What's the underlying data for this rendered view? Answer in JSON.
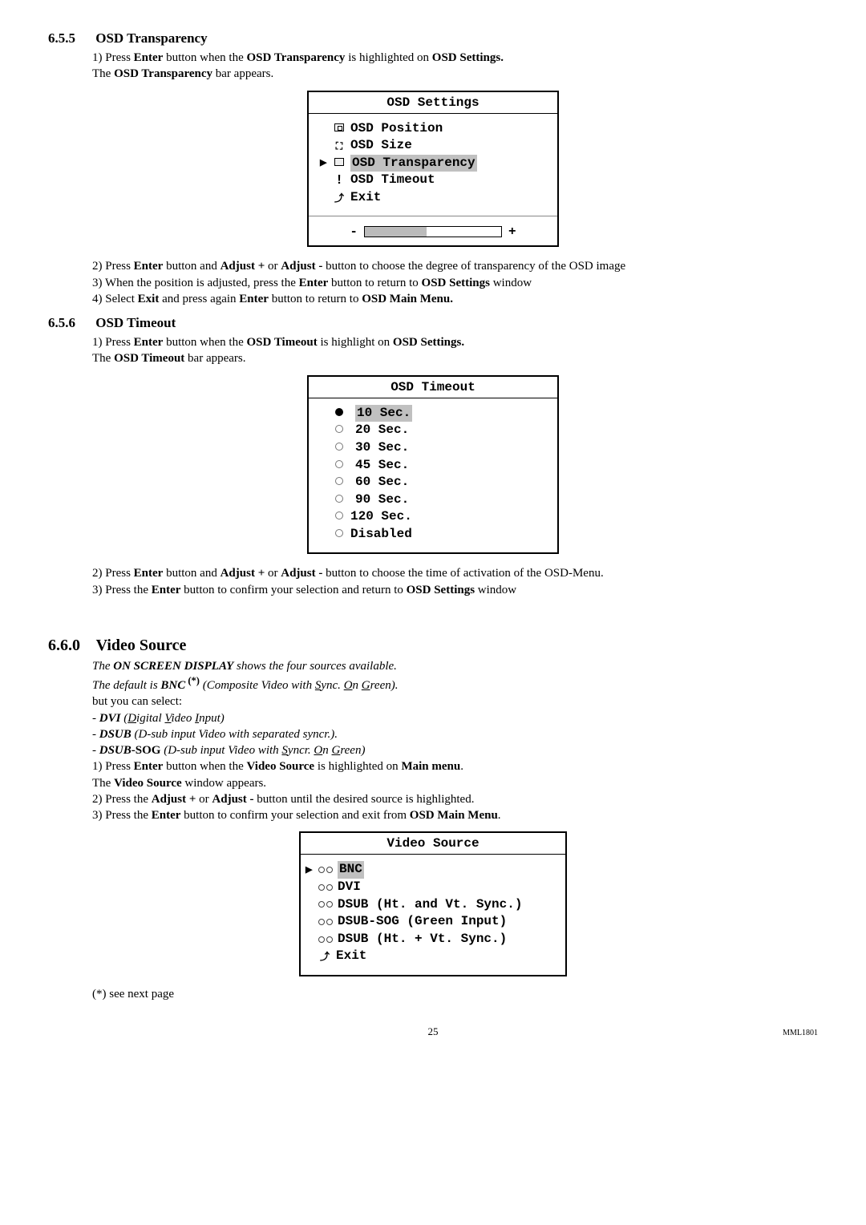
{
  "section655": {
    "num": "6.5.5",
    "title": "OSD Transparency",
    "step1_pre": "1) Press ",
    "step1_b1": "Enter",
    "step1_mid1": " button when the ",
    "step1_b2": "OSD Transparency",
    "step1_mid2": " is highlighted on ",
    "step1_b3": "OSD Settings.",
    "step1b_pre": "The ",
    "step1b_b": "OSD Transparency",
    "step1b_post": " bar appears.",
    "osd": {
      "title": "OSD Settings",
      "item_position": "OSD Position",
      "item_size": "OSD Size",
      "item_transparency": "OSD Transparency",
      "item_timeout": "OSD Timeout",
      "item_exit": "Exit",
      "minus": "-",
      "plus": "+"
    },
    "step2_pre": "2) Press ",
    "step2_b1": "Enter",
    "step2_mid1": " button and ",
    "step2_b2": "Adjust +",
    "step2_mid2": " or ",
    "step2_b3": "Adjust -",
    "step2_post": " button to choose the degree of transparency of the OSD image",
    "step3_pre": "3) When the position is adjusted, press the ",
    "step3_b1": "Enter",
    "step3_mid": " button to return to ",
    "step3_b2": "OSD Settings",
    "step3_post": " window",
    "step4_pre": "4) Select ",
    "step4_b1": "Exit",
    "step4_mid": " and press again ",
    "step4_b2": "Enter",
    "step4_mid2": " button to return to ",
    "step4_b3": "OSD Main Menu."
  },
  "section656": {
    "num": "6.5.6",
    "title": "OSD Timeout",
    "step1_pre": "1) Press ",
    "step1_b1": "Enter",
    "step1_mid1": " button when the ",
    "step1_b2": "OSD Timeout",
    "step1_mid2": " is highlight on ",
    "step1_b3": "OSD Settings.",
    "step1b_pre": "The ",
    "step1b_b": "OSD Timeout",
    "step1b_post": " bar appears.",
    "osd": {
      "title": "OSD Timeout",
      "opt_10": "10 Sec.",
      "opt_20": "20 Sec.",
      "opt_30": "30 Sec.",
      "opt_45": "45 Sec.",
      "opt_60": "60 Sec.",
      "opt_90": "90 Sec.",
      "opt_120": "120 Sec.",
      "opt_disabled": "Disabled"
    },
    "step2_pre": "2) Press ",
    "step2_b1": "Enter",
    "step2_mid1": " button and ",
    "step2_b2": "Adjust +",
    "step2_mid2": " or ",
    "step2_b3": "Adjust -",
    "step2_post": " button to choose the time of activation of the OSD-Menu.",
    "step3_pre": "3) Press the ",
    "step3_b1": "Enter",
    "step3_mid": " button to confirm your selection and return to ",
    "step3_b2": "OSD Settings",
    "step3_post": " window"
  },
  "section660": {
    "num": "6.6.0",
    "title": "Video Source",
    "intro_pre": "The ",
    "intro_b1": "ON SCREEN DISPLAY",
    "intro_post": " shows the four sources available.",
    "default_pre": " The default is ",
    "default_b": "BNC",
    "default_sup": " (*)",
    "default_post_open": " (Composite Video with ",
    "default_u1": "S",
    "default_t1": "ync. ",
    "default_u2": "O",
    "default_t2": "n ",
    "default_u3": "G",
    "default_t3": "reen).",
    "but_select": "but you can select:",
    "dvi_pre": " - ",
    "dvi_b": "DVI",
    "dvi_open": " (",
    "dvi_u1": "D",
    "dvi_t1": "igital ",
    "dvi_u2": "V",
    "dvi_t2": "ideo ",
    "dvi_u3": "I",
    "dvi_t3": "nput)",
    "dsub_pre": " - ",
    "dsub_b": "DSUB",
    "dsub_paren": " (D-sub input Video with separated syncr.).",
    "dsubsog_pre": " - ",
    "dsubsog_b1": "DSUB",
    "dsubsog_b2": "-SOG",
    "dsubsog_open": "  (D-sub input Video with ",
    "dsubsog_u1": "S",
    "dsubsog_t1": "yncr. ",
    "dsubsog_u2": "O",
    "dsubsog_t2": "n ",
    "dsubsog_u3": "G",
    "dsubsog_t3": "reen)",
    "step1_pre": "1) Press ",
    "step1_b1": "Enter",
    "step1_mid1": " button when the ",
    "step1_b2": "Video Source",
    "step1_mid2": " is highlighted on ",
    "step1_b3": "Main menu",
    "step1_end": ".",
    "step1b_pre": "The ",
    "step1b_b": "Video Source",
    "step1b_post": " window appears.",
    "step2_pre": "2) Press the ",
    "step2_b1": "Adjust +",
    "step2_mid1": " or ",
    "step2_b2": "Adjust -",
    "step2_post": " button until the desired source is highlighted.",
    "step3_pre": "3) Press the ",
    "step3_b1": "Enter",
    "step3_mid": " button to confirm your selection and exit from ",
    "step3_b2": "OSD Main Menu",
    "step3_end": ".",
    "osd": {
      "title": "Video Source",
      "opt_bnc": "BNC",
      "opt_dvi": "DVI",
      "opt_dsub1": "DSUB (Ht. and Vt. Sync.)",
      "opt_dsubsog": "DSUB-SOG (Green Input)",
      "opt_dsub2": "DSUB (Ht. + Vt. Sync.)",
      "opt_exit": "Exit"
    },
    "footnote": "(*) see next page"
  },
  "footer": {
    "page": "25",
    "model": "MML1801"
  }
}
